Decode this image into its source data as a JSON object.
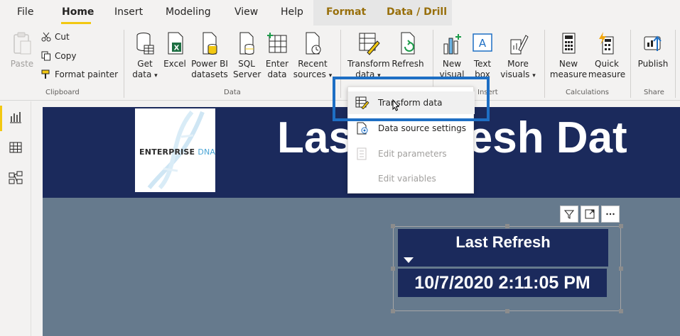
{
  "tabs": [
    "File",
    "Home",
    "Insert",
    "Modeling",
    "View",
    "Help"
  ],
  "context_tabs": [
    "Format",
    "Data / Drill"
  ],
  "clipboard": {
    "paste": "Paste",
    "cut": "Cut",
    "copy": "Copy",
    "format_painter": "Format painter",
    "group": "Clipboard"
  },
  "data_group": {
    "get_data": [
      "Get",
      "data"
    ],
    "excel": "Excel",
    "power_bi_datasets": [
      "Power BI",
      "datasets"
    ],
    "sql_server": [
      "SQL",
      "Server"
    ],
    "enter_data": [
      "Enter",
      "data"
    ],
    "recent_sources": [
      "Recent",
      "sources"
    ],
    "group": "Data"
  },
  "queries_group": {
    "transform_data": [
      "Transform",
      "data"
    ],
    "refresh": "Refresh"
  },
  "insert_group": {
    "new_visual": [
      "New",
      "visual"
    ],
    "text_box": [
      "Text",
      "box"
    ],
    "more_visuals": [
      "More",
      "visuals"
    ],
    "group": "Insert"
  },
  "calculations_group": {
    "new_measure": [
      "New",
      "measure"
    ],
    "quick_measure": [
      "Quick",
      "measure"
    ],
    "group": "Calculations"
  },
  "share_group": {
    "publish": "Publish",
    "group": "Share"
  },
  "dropdown": {
    "items": [
      "Transform data",
      "Data source settings",
      "Edit parameters",
      "Edit variables"
    ]
  },
  "report": {
    "banner_title": "Last Refresh Dat",
    "logo_main": "ENTERPRISE",
    "logo_accent": "DNA",
    "card_title": "Last Refresh",
    "card_value": "10/7/2020 2:11:05 PM"
  },
  "colors": {
    "accent": "#f2c811",
    "banner": "#1b2a5c",
    "canvas": "#667a8d",
    "highlight": "#1e6fc4",
    "format_tab": "#986f0b"
  }
}
